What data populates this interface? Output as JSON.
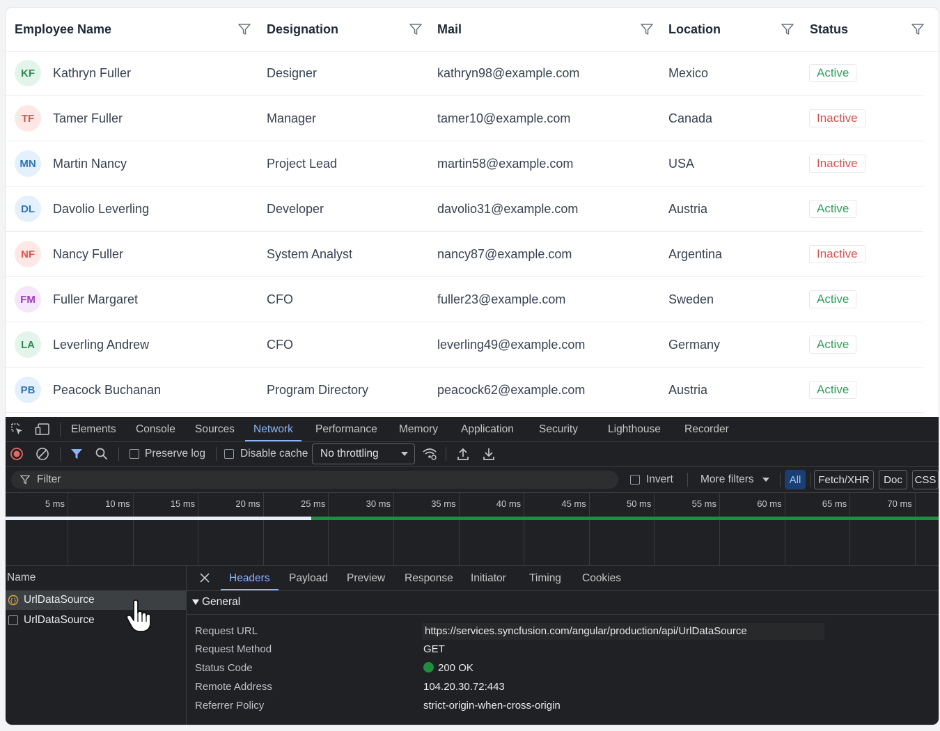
{
  "grid": {
    "columns": [
      {
        "label": "Employee Name"
      },
      {
        "label": "Designation"
      },
      {
        "label": "Mail"
      },
      {
        "label": "Location"
      },
      {
        "label": "Status"
      }
    ],
    "rows": [
      {
        "initials": "KF",
        "name": "Kathryn Fuller",
        "designation": "Designer",
        "mail": "kathryn98@example.com",
        "location": "Mexico",
        "status": "Active",
        "avatar_bg": "#e3f5ea",
        "avatar_fg": "#2f8a55"
      },
      {
        "initials": "TF",
        "name": "Tamer Fuller",
        "designation": "Manager",
        "mail": "tamer10@example.com",
        "location": "Canada",
        "status": "Inactive",
        "avatar_bg": "#fde8e6",
        "avatar_fg": "#d9534f"
      },
      {
        "initials": "MN",
        "name": "Martin Nancy",
        "designation": "Project Lead",
        "mail": "martin58@example.com",
        "location": "USA",
        "status": "Inactive",
        "avatar_bg": "#e4f0fb",
        "avatar_fg": "#2f75b5"
      },
      {
        "initials": "DL",
        "name": "Davolio Leverling",
        "designation": "Developer",
        "mail": "davolio31@example.com",
        "location": "Austria",
        "status": "Active",
        "avatar_bg": "#e4f0fb",
        "avatar_fg": "#2f75b5"
      },
      {
        "initials": "NF",
        "name": "Nancy Fuller",
        "designation": "System Analyst",
        "mail": "nancy87@example.com",
        "location": "Argentina",
        "status": "Inactive",
        "avatar_bg": "#fde8e6",
        "avatar_fg": "#d9534f"
      },
      {
        "initials": "FM",
        "name": "Fuller Margaret",
        "designation": "CFO",
        "mail": "fuller23@example.com",
        "location": "Sweden",
        "status": "Active",
        "avatar_bg": "#f5e6fa",
        "avatar_fg": "#a23dbf"
      },
      {
        "initials": "LA",
        "name": "Leverling Andrew",
        "designation": "CFO",
        "mail": "leverling49@example.com",
        "location": "Germany",
        "status": "Active",
        "avatar_bg": "#e3f5ea",
        "avatar_fg": "#2f8a55"
      },
      {
        "initials": "PB",
        "name": "Peacock Buchanan",
        "designation": "Program Directory",
        "mail": "peacock62@example.com",
        "location": "Austria",
        "status": "Active",
        "avatar_bg": "#e4f0fb",
        "avatar_fg": "#2f75b5"
      }
    ],
    "status_colors": {
      "Active": "#2f9e5b",
      "Inactive": "#d9534f"
    }
  },
  "devtools": {
    "tabs": [
      "Elements",
      "Console",
      "Sources",
      "Network",
      "Performance",
      "Memory",
      "Application",
      "Security",
      "Lighthouse",
      "Recorder"
    ],
    "active_tab": "Network",
    "toolbar": {
      "preserve_log": "Preserve log",
      "disable_cache": "Disable cache",
      "throttling": "No throttling"
    },
    "filter": {
      "placeholder": "Filter",
      "invert": "Invert",
      "more_filters": "More filters",
      "chips": [
        "All",
        "Fetch/XHR",
        "Doc",
        "CSS"
      ]
    },
    "timeline": {
      "ticks": [
        "5 ms",
        "10 ms",
        "15 ms",
        "20 ms",
        "25 ms",
        "30 ms",
        "35 ms",
        "40 ms",
        "45 ms",
        "50 ms",
        "55 ms",
        "60 ms",
        "65 ms",
        "70 ms"
      ]
    },
    "requests": {
      "header": "Name",
      "items": [
        "UrlDataSource",
        "UrlDataSource"
      ]
    },
    "detail_tabs": [
      "Headers",
      "Payload",
      "Preview",
      "Response",
      "Initiator",
      "Timing",
      "Cookies"
    ],
    "active_detail_tab": "Headers",
    "general": {
      "section": "General",
      "rows": [
        {
          "key": "Request URL",
          "value": "https://services.syncfusion.com/angular/production/api/UrlDataSource"
        },
        {
          "key": "Request Method",
          "value": "GET"
        },
        {
          "key": "Status Code",
          "value": "200 OK"
        },
        {
          "key": "Remote Address",
          "value": "104.20.30.72:443"
        },
        {
          "key": "Referrer Policy",
          "value": "strict-origin-when-cross-origin"
        }
      ]
    },
    "colors": {
      "accent": "#8ab4f8",
      "record": "#e46962",
      "status_ok": "#1e8e3e"
    }
  }
}
